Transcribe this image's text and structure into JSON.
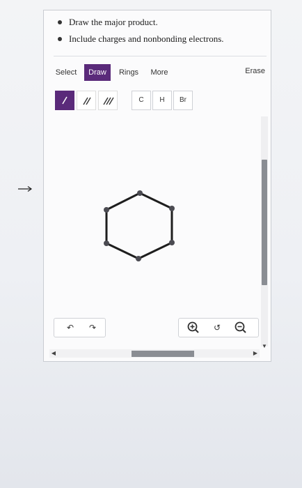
{
  "instructions": [
    "Draw the major product.",
    "Include charges and nonbonding electrons."
  ],
  "toolbar": {
    "tabs": [
      "Select",
      "Draw",
      "Rings",
      "More"
    ],
    "active_tab": "Draw",
    "erase_label": "Erase"
  },
  "bonds": {
    "single_label": "/",
    "double_label": "//",
    "triple_label": "///",
    "active": "single"
  },
  "atoms": [
    "C",
    "H",
    "Br"
  ],
  "controls": {
    "undo_icon": "undo-icon",
    "redo_icon": "redo-icon",
    "zoom_in_icon": "zoom-in-icon",
    "reset_icon": "reset-zoom-icon",
    "zoom_out_icon": "zoom-out-icon"
  },
  "colors": {
    "accent": "#5a2a7a",
    "scroll_thumb": "#8a8d93"
  },
  "molecule": {
    "name": "cyclohexane ring skeleton",
    "atoms": 6,
    "bonds": 6
  }
}
